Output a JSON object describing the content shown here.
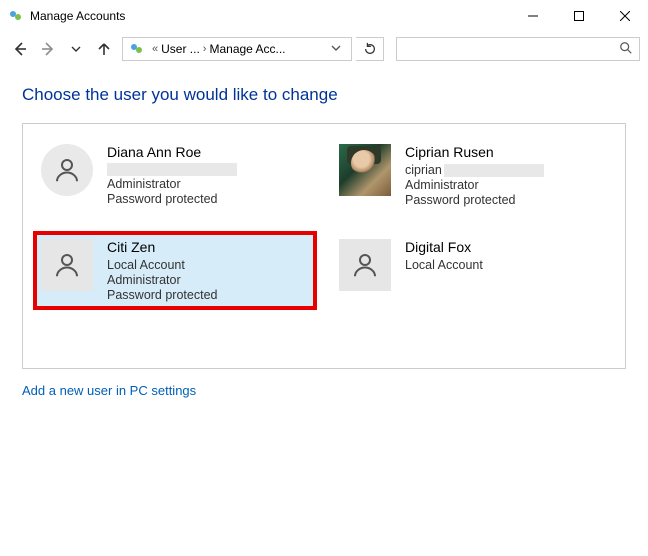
{
  "window": {
    "title": "Manage Accounts"
  },
  "breadcrumb": {
    "seg1": "User ...",
    "seg2": "Manage Acc..."
  },
  "heading": "Choose the user you would like to change",
  "users": [
    {
      "name": "Diana Ann Roe",
      "line2_redacted": true,
      "line3": "Administrator",
      "line4": "Password protected"
    },
    {
      "name": "Ciprian Rusen",
      "line2_redacted_prefix": "ciprian",
      "line3": "Administrator",
      "line4": "Password protected"
    },
    {
      "name": "Citi Zen",
      "line2": "Local Account",
      "line3": "Administrator",
      "line4": "Password protected"
    },
    {
      "name": "Digital Fox",
      "line2": "Local Account"
    }
  ],
  "add_link": "Add a new user in PC settings"
}
